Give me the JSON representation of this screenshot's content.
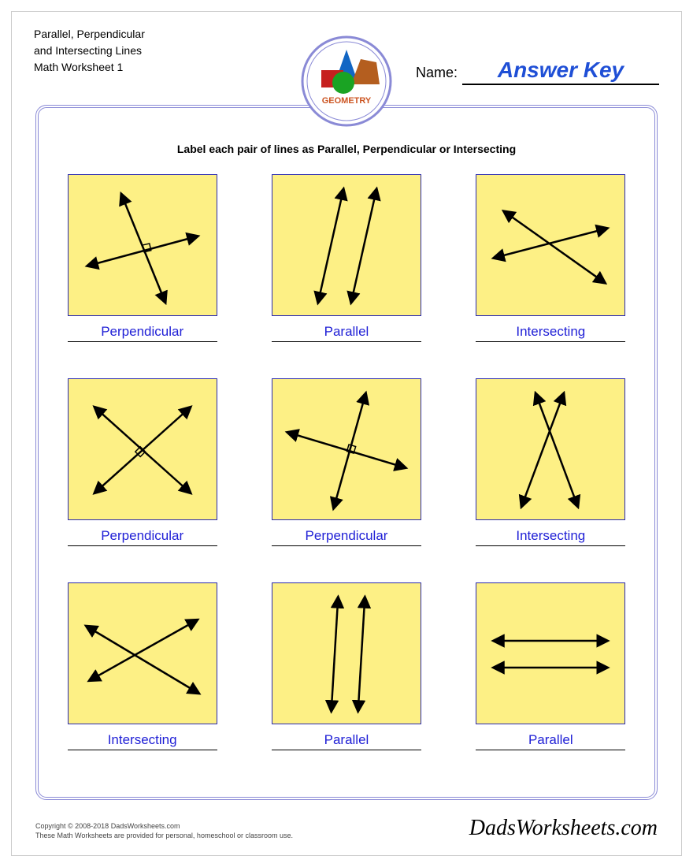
{
  "header": {
    "title_line1": "Parallel, Perpendicular",
    "title_line2": "and Intersecting Lines",
    "title_line3": "Math Worksheet 1",
    "logo_label": "GEOMETRY",
    "name_label": "Name:",
    "name_value": "Answer Key"
  },
  "instruction": "Label each pair of lines as Parallel, Perpendicular or Intersecting",
  "problems": [
    {
      "type": "perpendicular",
      "answer": "Perpendicular"
    },
    {
      "type": "parallel",
      "answer": "Parallel"
    },
    {
      "type": "intersecting",
      "answer": "Intersecting"
    },
    {
      "type": "perpendicular",
      "answer": "Perpendicular"
    },
    {
      "type": "perpendicular",
      "answer": "Perpendicular"
    },
    {
      "type": "intersecting",
      "answer": "Intersecting"
    },
    {
      "type": "intersecting",
      "answer": "Intersecting"
    },
    {
      "type": "parallel",
      "answer": "Parallel"
    },
    {
      "type": "parallel",
      "answer": "Parallel"
    }
  ],
  "footer": {
    "copyright": "Copyright © 2008-2018 DadsWorksheets.com",
    "note": "These Math Worksheets are provided for personal, homeschool or classroom use.",
    "brand": "DadsWorksheets.com"
  },
  "colors": {
    "accent_blue": "#1f4fd6",
    "frame": "#8a8ad6",
    "tile_bg": "#fdf085",
    "tile_border": "#2a2ab0"
  }
}
